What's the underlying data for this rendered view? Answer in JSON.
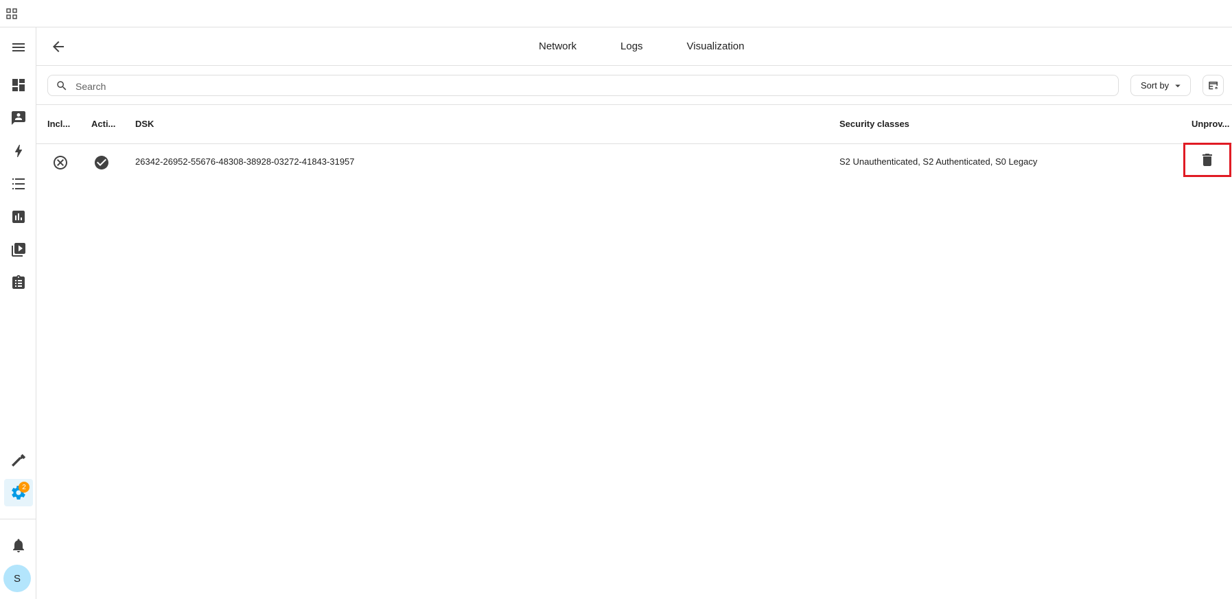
{
  "colors": {
    "accent": "#039be5",
    "badge": "#ff9800",
    "highlight": "#e01b24"
  },
  "sidebar": {
    "items": [
      {
        "icon": "menu-icon"
      },
      {
        "icon": "dashboard-icon"
      },
      {
        "icon": "person-board-icon"
      },
      {
        "icon": "lightning-icon"
      },
      {
        "icon": "list-icon"
      },
      {
        "icon": "bar-chart-icon"
      },
      {
        "icon": "media-icon"
      },
      {
        "icon": "clipboard-icon"
      },
      {
        "icon": "hammer-icon"
      },
      {
        "icon": "gear-icon",
        "badge": "2"
      },
      {
        "icon": "bell-icon"
      }
    ],
    "settings_badge": "2",
    "avatar_initial": "S"
  },
  "header": {
    "tabs": [
      {
        "label": "Network"
      },
      {
        "label": "Logs"
      },
      {
        "label": "Visualization"
      }
    ]
  },
  "search": {
    "placeholder": "Search",
    "value": ""
  },
  "toolbar": {
    "sort_label": "Sort by"
  },
  "table": {
    "columns": [
      "Incl...",
      "Acti...",
      "DSK",
      "Security classes",
      "Unprov..."
    ],
    "rows": [
      {
        "included_icon": "cancel-circle-icon",
        "active_icon": "check-circle-icon",
        "dsk": "26342-26952-55676-48308-38928-03272-41843-31957",
        "security_classes": "S2 Unauthenticated, S2 Authenticated, S0 Legacy",
        "action_icon": "trash-icon"
      }
    ]
  }
}
